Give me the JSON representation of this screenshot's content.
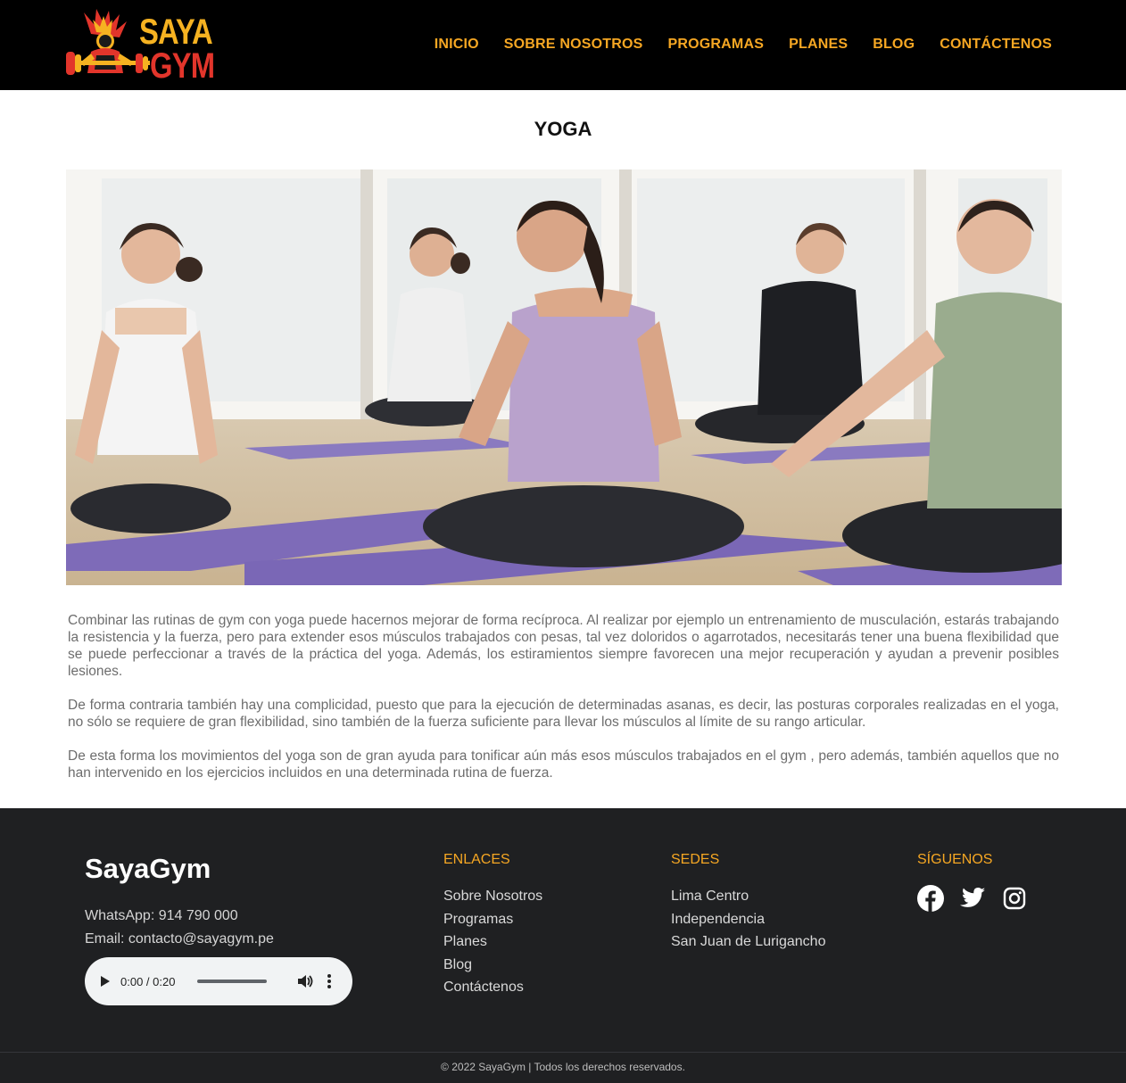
{
  "header": {
    "logo": {
      "line1": "SAYA",
      "line2": "GYM",
      "colors": {
        "primary": "#f6b221",
        "secondary": "#e2352b"
      },
      "icon": "weightlifter-emblem"
    },
    "nav": [
      {
        "label": "INICIO"
      },
      {
        "label": "SOBRE NOSOTROS"
      },
      {
        "label": "PROGRAMAS"
      },
      {
        "label": "PLANES"
      },
      {
        "label": "BLOG"
      },
      {
        "label": "CONTÁCTENOS"
      }
    ],
    "nav_color": "#f6a723"
  },
  "main": {
    "title": "YOGA",
    "hero_image": "yoga-class-photo",
    "paragraphs": [
      "Combinar las rutinas de gym con yoga puede hacernos mejorar de forma recíproca. Al realizar por ejemplo un entrenamiento de musculación, estarás trabajando la resistencia y la fuerza, pero para extender esos músculos trabajados con pesas, tal vez doloridos o agarrotados, necesitarás tener una buena flexibilidad que se puede perfeccionar a través de la práctica del yoga. Además, los estiramientos siempre favorecen una mejor recuperación y ayudan a prevenir posibles lesiones.",
      "De forma contraria también hay una complicidad, puesto que para la ejecución de determinadas asanas, es decir, las posturas corporales realizadas en el yoga, no sólo se requiere de gran flexibilidad, sino también de la fuerza suficiente para llevar los músculos al límite de su rango articular.",
      "De esta forma los movimientos del yoga son de gran ayuda para tonificar aún más esos músculos trabajados en el gym , pero además, también aquellos que no han intervenido en los ejercicios incluidos en una determinada rutina de fuerza."
    ]
  },
  "footer": {
    "brand": "SayaGym",
    "whatsapp": "WhatsApp: 914 790 000",
    "email": "Email: contacto@sayagym.pe",
    "audio": {
      "time": "0:00 / 0:20"
    },
    "enlaces": {
      "title": "ENLACES",
      "items": [
        "Sobre Nosotros",
        "Programas",
        "Planes",
        "Blog",
        "Contáctenos"
      ]
    },
    "sedes": {
      "title": "SEDES",
      "items": [
        "Lima Centro",
        "Independencia",
        "San Juan de Lurigancho"
      ]
    },
    "siguenos": {
      "title": "SÍGUENOS",
      "icons": [
        "facebook-icon",
        "twitter-icon",
        "instagram-icon"
      ]
    },
    "copyright": "© 2022 SayaGym | Todos los derechos reservados.",
    "colors": {
      "background": "#1f2022",
      "accent": "#f6a723"
    }
  }
}
